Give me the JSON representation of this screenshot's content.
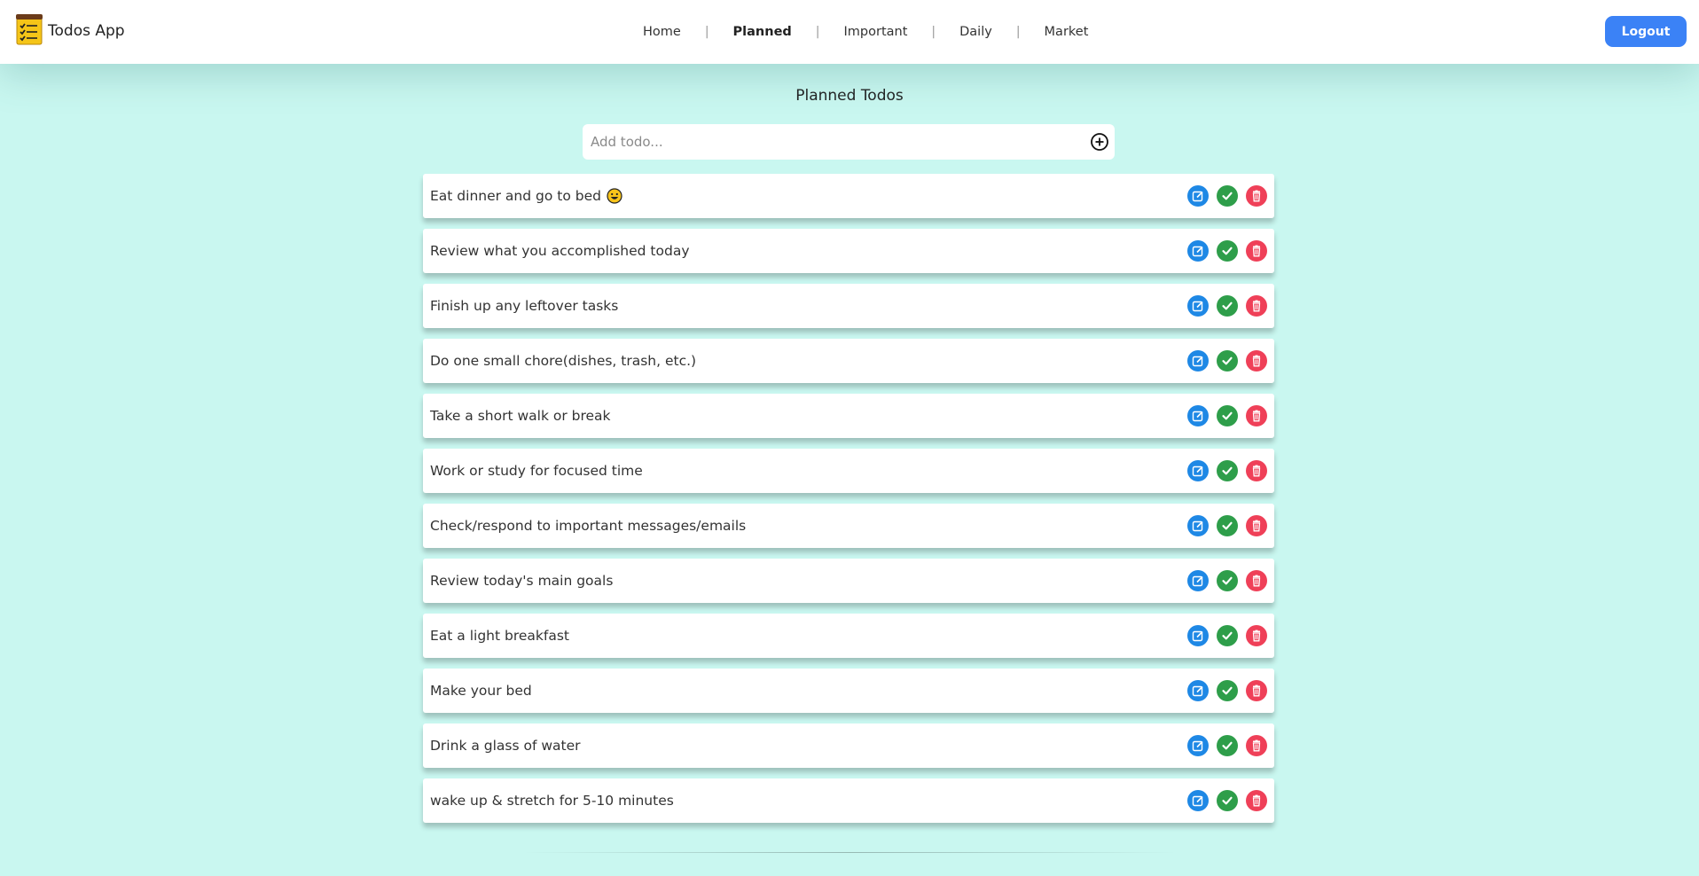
{
  "app": {
    "name": "Todos App",
    "logo_icon": "notepad-checklist-icon"
  },
  "nav": {
    "links": [
      {
        "label": "Home",
        "active": false
      },
      {
        "label": "Planned",
        "active": true
      },
      {
        "label": "Important",
        "active": false
      },
      {
        "label": "Daily",
        "active": false
      },
      {
        "label": "Market",
        "active": false
      }
    ],
    "separator": "|"
  },
  "logout_label": "Logout",
  "page": {
    "title": "Planned Todos",
    "add_placeholder": "Add todo...",
    "add_icon": "plus-circle-icon"
  },
  "todos": [
    {
      "text": "Eat dinner and go to bed",
      "emoji": "smiley-emoji"
    },
    {
      "text": "Review what you accomplished today"
    },
    {
      "text": "Finish up any leftover tasks"
    },
    {
      "text": "Do one small chore(dishes, trash, etc.)"
    },
    {
      "text": "Take a short walk or break"
    },
    {
      "text": "Work or study for focused time"
    },
    {
      "text": "Check/respond to important messages/emails"
    },
    {
      "text": "Review today's main goals"
    },
    {
      "text": "Eat a light breakfast"
    },
    {
      "text": "Make your bed"
    },
    {
      "text": "Drink a glass of water"
    },
    {
      "text": "wake up & stretch for 5-10 minutes"
    }
  ],
  "actions": {
    "edit_icon": "edit-icon",
    "done_icon": "check-icon",
    "delete_icon": "trash-icon"
  },
  "colors": {
    "background": "#c9f7f0",
    "accent": "#3b82f6",
    "edit": "#1e88e5",
    "done": "#2e9e4a",
    "delete": "#ef4058"
  }
}
